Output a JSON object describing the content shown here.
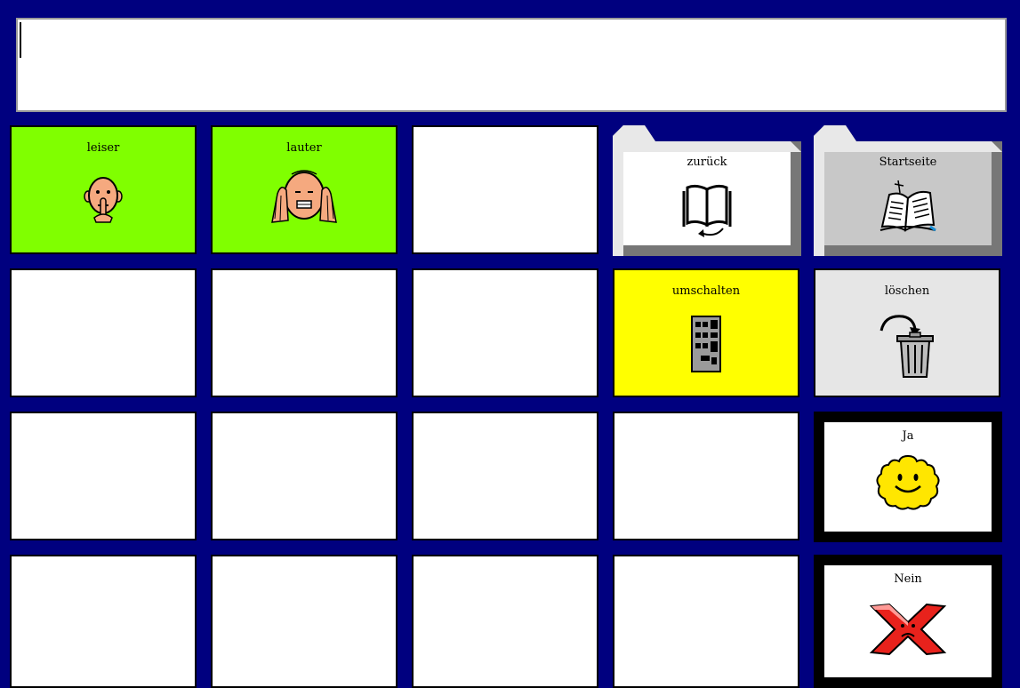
{
  "message_bar": {
    "text": ""
  },
  "buttons": {
    "leiser": {
      "label": "leiser",
      "icon": "face-shush-icon"
    },
    "lauter": {
      "label": "lauter",
      "icon": "face-covering-ears-icon"
    },
    "zurueck": {
      "label": "zurück",
      "icon": "book-back-icon"
    },
    "startseite": {
      "label": "Startseite",
      "icon": "open-book-icon"
    },
    "umschalten": {
      "label": "umschalten",
      "icon": "keyboard-icon"
    },
    "loeschen": {
      "label": "löschen",
      "icon": "trash-icon"
    },
    "ja": {
      "label": "Ja",
      "icon": "smiley-icon"
    },
    "nein": {
      "label": "Nein",
      "icon": "red-x-icon"
    }
  },
  "colors": {
    "background": "#00007f",
    "green": "#80ff00",
    "yellow": "#ffff00",
    "light_gray": "#e6e6e6",
    "folder_gray": "#c8c8c8"
  }
}
